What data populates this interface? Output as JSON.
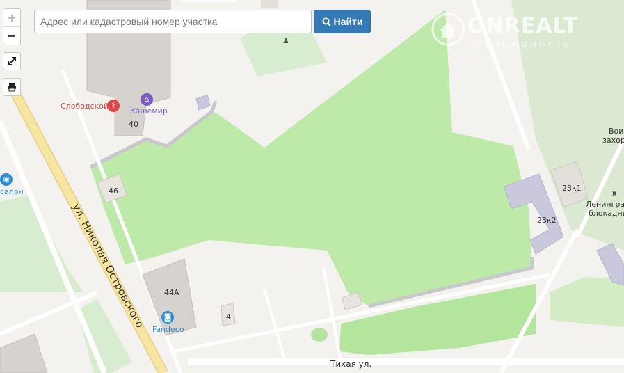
{
  "search": {
    "placeholder": "Адрес или кадастровый номер участка",
    "button_label": "Найти",
    "button_icon": "search-icon"
  },
  "controls": {
    "zoom_in": "+",
    "zoom_out": "−",
    "fullscreen_icon": "expand-icon",
    "print_icon": "printer-icon"
  },
  "logo": {
    "name": "ONREALT",
    "tagline": "НЕДВИЖИМОСТЬ"
  },
  "map": {
    "colors": {
      "background": "#f4f2ee",
      "green_area": "#bdeaa8",
      "park": "#d8ecd0",
      "building": "#d9d6d0",
      "road_major": "#f7e6a0",
      "road_minor": "#ffffff"
    },
    "street_labels": {
      "main_street": "ул. Николая Островского",
      "tikhaya": "Тихая ул."
    },
    "house_numbers": {
      "h40": "40",
      "h46": "46",
      "h44a": "44А",
      "h4": "4",
      "h23k1": "23к1",
      "h23k2": "23к2"
    },
    "pois": {
      "slobodskoy": "Слободской",
      "kashemir": "Кашемир",
      "fandeco": "Fandeco",
      "salon": "салон",
      "memorial_1": "Вои",
      "memorial_2": "захор",
      "leningrad_1": "Ленинград",
      "leningrad_2": "блокадни"
    }
  }
}
